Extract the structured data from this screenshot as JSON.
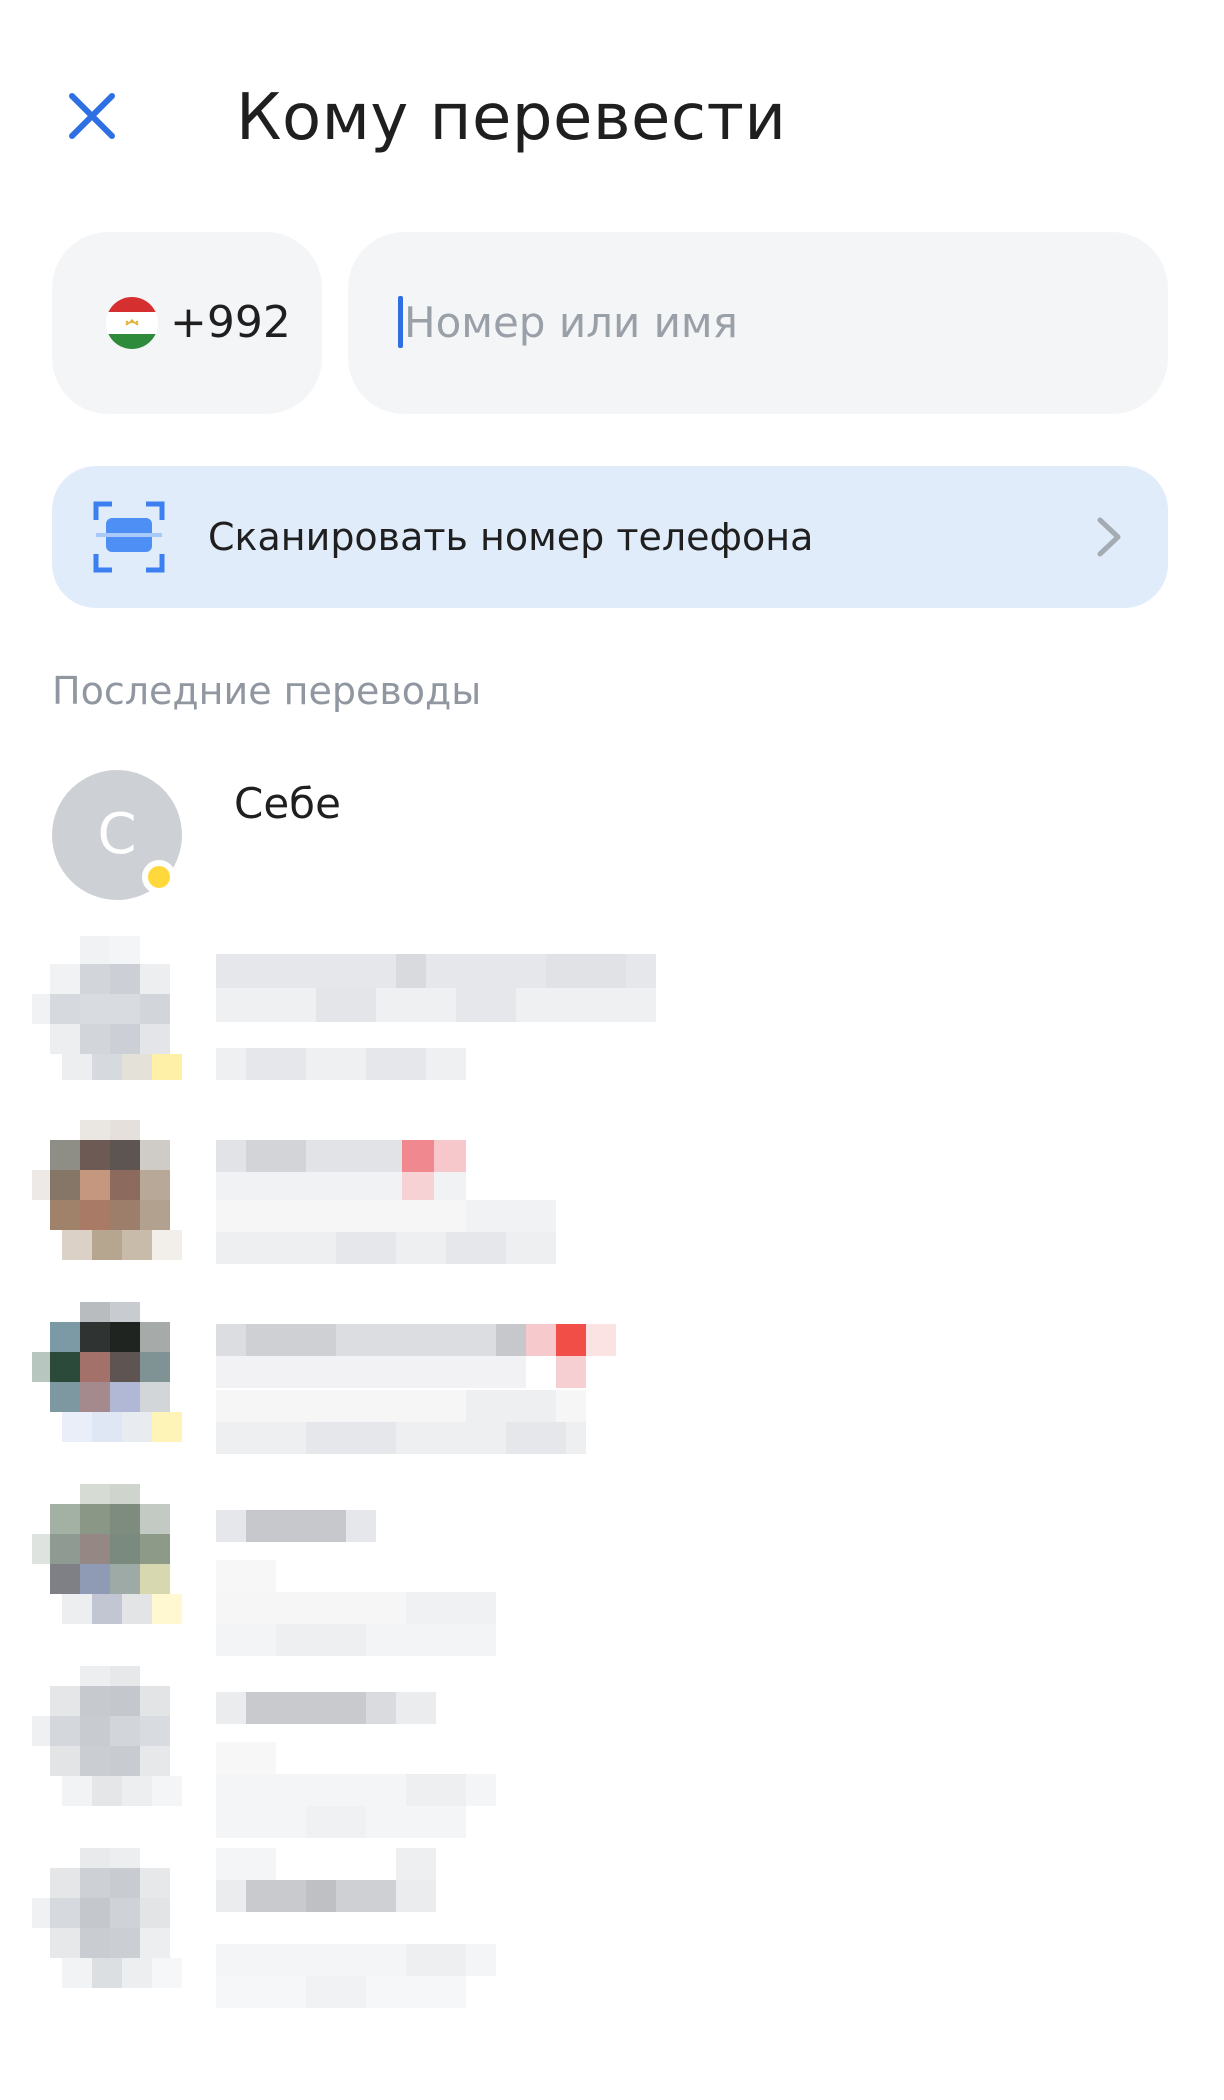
{
  "header": {
    "title": "Кому перевести",
    "close_icon": "close-icon"
  },
  "phone_input": {
    "country_code": "+992",
    "flag_icon": "tajikistan-flag-icon",
    "placeholder": "Номер или имя",
    "value": ""
  },
  "scan": {
    "label": "Сканировать номер телефона",
    "icon": "scan-frame-icon",
    "chevron_icon": "chevron-right-icon"
  },
  "recent": {
    "section_title": "Последние переводы",
    "self": {
      "initial": "С",
      "name": "Себе",
      "status_color": "#ffd93b"
    }
  },
  "colors": {
    "accent": "#2f6fe4",
    "field_bg": "#f4f5f7",
    "scan_bg": "#e1ecfb",
    "muted_text": "#9097a0"
  }
}
